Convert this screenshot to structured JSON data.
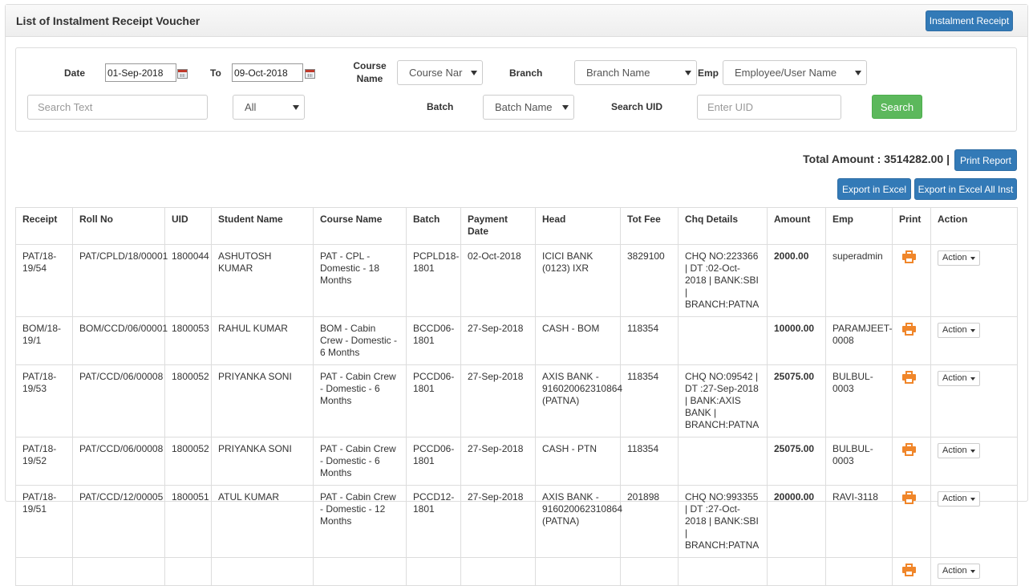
{
  "header": {
    "title": "List of Instalment Receipt Voucher",
    "instalment_receipt_button": "Instalment Receipt"
  },
  "filters": {
    "date_label": "Date",
    "date_from": "01-Sep-2018",
    "to_label": "To",
    "date_to": "09-Oct-2018",
    "course_label": "Course Name",
    "course_select": "Course Nar",
    "branch_label": "Branch",
    "branch_select": "Branch Name",
    "emp_label": "Emp",
    "emp_select": "Employee/User Name",
    "search_text_placeholder": "Search Text",
    "all_select": "All",
    "batch_label": "Batch",
    "batch_select": "Batch Name",
    "search_uid_label": "Search UID",
    "uid_placeholder": "Enter UID",
    "search_button": "Search"
  },
  "summary": {
    "total_text": "Total Amount : 3514282.00 |",
    "print_report_button": "Print Report",
    "export_excel_button": "Export in Excel",
    "export_excel_all_button": "Export in Excel All Inst"
  },
  "table": {
    "columns": [
      "Receipt",
      "Roll No",
      "UID",
      "Student Name",
      "Course Name",
      "Batch",
      "Payment Date",
      "Head",
      "Tot Fee",
      "Chq Details",
      "Amount",
      "Emp",
      "Print",
      "Action"
    ],
    "action_label": "Action",
    "rows": [
      {
        "receipt": "PAT/18-19/54",
        "roll": "PAT/CPLD/18/00001",
        "uid": "1800044",
        "student": "ASHUTOSH KUMAR",
        "course": "PAT - CPL - Domestic - 18 Months",
        "batch": "PCPLD18-1801",
        "date": "02-Oct-2018",
        "head": "ICICI BANK (0123) IXR",
        "fee": "3829100",
        "chq": "CHQ NO:223366 | DT :02-Oct-2018 | BANK:SBI | BRANCH:PATNA",
        "amount": "2000.00",
        "emp": "superadmin"
      },
      {
        "receipt": "BOM/18-19/1",
        "roll": "BOM/CCD/06/00001",
        "uid": "1800053",
        "student": "RAHUL KUMAR",
        "course": "BOM - Cabin Crew - Domestic - 6 Months",
        "batch": "BCCD06-1801",
        "date": "27-Sep-2018",
        "head": "CASH - BOM",
        "fee": "118354",
        "chq": "",
        "amount": "10000.00",
        "emp": "PARAMJEET-0008"
      },
      {
        "receipt": "PAT/18-19/53",
        "roll": "PAT/CCD/06/00008",
        "uid": "1800052",
        "student": "PRIYANKA SONI",
        "course": "PAT - Cabin Crew - Domestic - 6 Months",
        "batch": "PCCD06-1801",
        "date": "27-Sep-2018",
        "head": "AXIS BANK - 916020062310864 (PATNA)",
        "fee": "118354",
        "chq": "CHQ NO:09542 | DT :27-Sep-2018 | BANK:AXIS BANK | BRANCH:PATNA",
        "amount": "25075.00",
        "emp": "BULBUL-0003"
      },
      {
        "receipt": "PAT/18-19/52",
        "roll": "PAT/CCD/06/00008",
        "uid": "1800052",
        "student": "PRIYANKA SONI",
        "course": "PAT - Cabin Crew - Domestic - 6 Months",
        "batch": "PCCD06-1801",
        "date": "27-Sep-2018",
        "head": "CASH - PTN",
        "fee": "118354",
        "chq": "",
        "amount": "25075.00",
        "emp": "BULBUL-0003"
      },
      {
        "receipt": "PAT/18-19/51",
        "roll": "PAT/CCD/12/00005",
        "uid": "1800051",
        "student": "ATUL KUMAR",
        "course": "PAT - Cabin Crew - Domestic - 12 Months",
        "batch": "PCCD12-1801",
        "date": "27-Sep-2018",
        "head": "AXIS BANK - 916020062310864 (PATNA)",
        "fee": "201898",
        "chq": "CHQ NO:993355 | DT :27-Oct-2018 | BANK:SBI | BRANCH:PATNA",
        "amount": "20000.00",
        "emp": "RAVI-3118"
      },
      {
        "receipt": "",
        "roll": "",
        "uid": "",
        "student": "",
        "course": "",
        "batch": "",
        "date": "",
        "head": "",
        "fee": "",
        "chq": "",
        "amount": "",
        "emp": ""
      }
    ]
  },
  "colors": {
    "primary": "#337ab7",
    "success": "#5cb85c",
    "print_icon": "#f0862a"
  }
}
